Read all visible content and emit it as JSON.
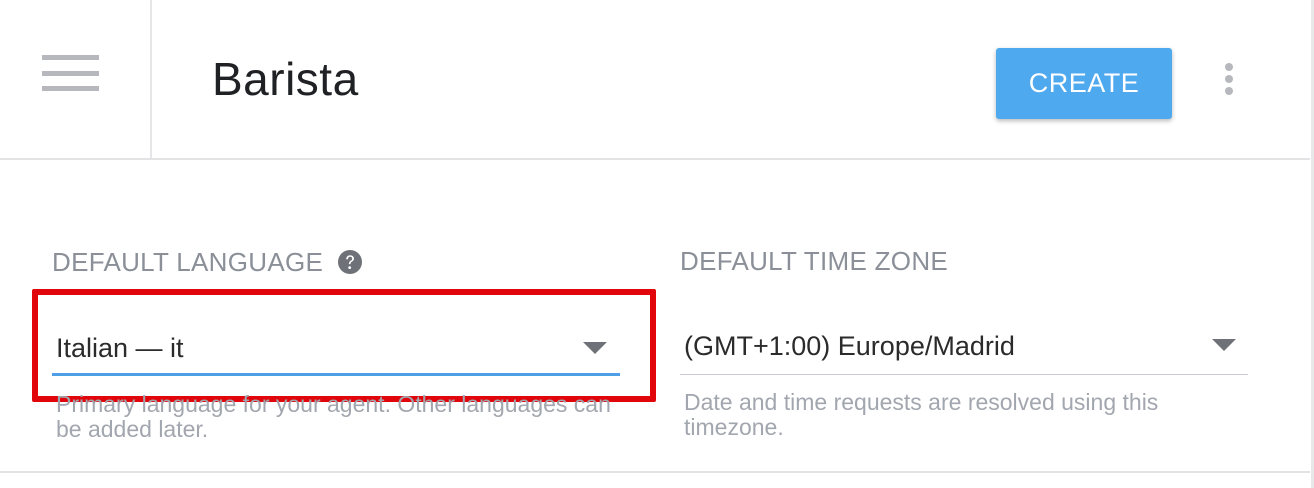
{
  "header": {
    "title": "Barista",
    "create_label": "CREATE"
  },
  "language": {
    "label": "DEFAULT LANGUAGE",
    "value": "Italian — it",
    "hint": "Primary language for your agent. Other languages can be added later."
  },
  "timezone": {
    "label": "DEFAULT TIME ZONE",
    "value": "(GMT+1:00) Europe/Madrid",
    "hint": "Date and time requests are resolved using this timezone."
  },
  "colors": {
    "accent": "#4fa9ef",
    "highlight_border": "#e0060b",
    "active_underline": "#4f9fe6"
  },
  "icons": {
    "menu": "hamburger-menu-icon",
    "more": "vertical-dots-icon",
    "help": "question-circle-icon",
    "dropdown": "caret-down-icon"
  }
}
